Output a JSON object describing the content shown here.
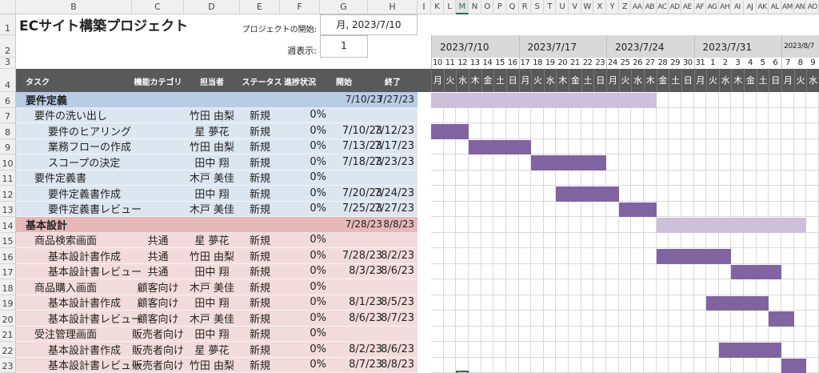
{
  "title": "ECサイト構築プロジェクト",
  "project_start_label": "プロジェクトの開始:",
  "project_start_value": "月, 2023/7/10",
  "week_display_label": "週表示:",
  "week_display_value": "1",
  "columns_left": [
    "B",
    "C",
    "D",
    "E",
    "F",
    "G",
    "H",
    "I"
  ],
  "columns_gantt": [
    "K",
    "L",
    "M",
    "N",
    "O",
    "P",
    "Q",
    "R",
    "S",
    "T",
    "U",
    "V",
    "W",
    "X",
    "Y",
    "Z",
    "AA",
    "AB",
    "AC",
    "AD",
    "AE",
    "AF",
    "AG",
    "AH",
    "AI",
    "AJ",
    "AK",
    "AL",
    "AM",
    "AN",
    "AO"
  ],
  "selected_column": "M",
  "headers": {
    "task": "タスク",
    "category": "機能カテゴリ",
    "owner": "担当者",
    "status": "ステータス",
    "progress": "進捗状況",
    "start": "開始",
    "end": "終了"
  },
  "weeks": [
    "2023/7/10",
    "2023/7/17",
    "2023/7/24",
    "2023/7/31",
    "2023/8/7"
  ],
  "day_numbers": [
    "10",
    "11",
    "12",
    "13",
    "14",
    "15",
    "16",
    "17",
    "18",
    "19",
    "20",
    "21",
    "22",
    "23",
    "24",
    "25",
    "26",
    "27",
    "28",
    "29",
    "30",
    "31",
    "1",
    "2",
    "3",
    "4",
    "5",
    "6",
    "7",
    "8",
    "9"
  ],
  "weekdays": [
    "月",
    "火",
    "水",
    "木",
    "金",
    "土",
    "日",
    "月",
    "火",
    "水",
    "木",
    "金",
    "土",
    "日",
    "月",
    "火",
    "水",
    "木",
    "金",
    "土",
    "日",
    "月",
    "火",
    "水",
    "木",
    "金",
    "土",
    "日",
    "月",
    "火",
    "水"
  ],
  "colors": {
    "header_dark": "#595959",
    "phase1": "#b8cce4",
    "phase1_light": "#dce6f1",
    "phase2": "#e6b8b7",
    "phase2_light": "#f2dcdb",
    "bar": "#8064a2",
    "bar_phase": "#ccc0da",
    "gantt_header": "#d9d9d9"
  },
  "rows": [
    {
      "num": "6",
      "level": 0,
      "phase": 1,
      "task": "要件定義",
      "category": "",
      "owner": "",
      "status": "",
      "progress": "",
      "start": "7/10/23",
      "end": "7/27/23"
    },
    {
      "num": "7",
      "level": 1,
      "phase": 1,
      "task": "要件の洗い出し",
      "category": "",
      "owner": "竹田 由梨",
      "status": "新規",
      "progress": "0%",
      "start": "",
      "end": ""
    },
    {
      "num": "8",
      "level": 2,
      "phase": 1,
      "task": "要件のヒアリング",
      "category": "",
      "owner": "星 夢花",
      "status": "新規",
      "progress": "0%",
      "start": "7/10/23",
      "end": "7/12/23"
    },
    {
      "num": "9",
      "level": 2,
      "phase": 1,
      "task": "業務フローの作成",
      "category": "",
      "owner": "竹田 由梨",
      "status": "新規",
      "progress": "0%",
      "start": "7/13/23",
      "end": "7/17/23"
    },
    {
      "num": "10",
      "level": 2,
      "phase": 1,
      "task": "スコープの決定",
      "category": "",
      "owner": "田中 翔",
      "status": "新規",
      "progress": "0%",
      "start": "7/18/23",
      "end": "7/23/23"
    },
    {
      "num": "11",
      "level": 1,
      "phase": 1,
      "task": "要件定義書",
      "category": "",
      "owner": "木戸 美佳",
      "status": "新規",
      "progress": "0%",
      "start": "",
      "end": ""
    },
    {
      "num": "12",
      "level": 2,
      "phase": 1,
      "task": "要件定義書作成",
      "category": "",
      "owner": "田中 翔",
      "status": "新規",
      "progress": "0%",
      "start": "7/20/23",
      "end": "7/24/23"
    },
    {
      "num": "13",
      "level": 2,
      "phase": 1,
      "task": "要件定義書レビュー",
      "category": "",
      "owner": "木戸 美佳",
      "status": "新規",
      "progress": "0%",
      "start": "7/25/23",
      "end": "7/27/23"
    },
    {
      "num": "14",
      "level": 0,
      "phase": 2,
      "task": "基本設計",
      "category": "",
      "owner": "",
      "status": "",
      "progress": "",
      "start": "7/28/23",
      "end": "8/8/23"
    },
    {
      "num": "15",
      "level": 1,
      "phase": 2,
      "task": "商品検索画面",
      "category": "共通",
      "owner": "星 夢花",
      "status": "新規",
      "progress": "0%",
      "start": "",
      "end": ""
    },
    {
      "num": "16",
      "level": 2,
      "phase": 2,
      "task": "基本設計書作成",
      "category": "共通",
      "owner": "竹田 由梨",
      "status": "新規",
      "progress": "0%",
      "start": "7/28/23",
      "end": "8/2/23"
    },
    {
      "num": "17",
      "level": 2,
      "phase": 2,
      "task": "基本設計書レビュー",
      "category": "共通",
      "owner": "田中 翔",
      "status": "新規",
      "progress": "0%",
      "start": "8/3/23",
      "end": "8/6/23"
    },
    {
      "num": "18",
      "level": 1,
      "phase": 2,
      "task": "商品購入画面",
      "category": "顧客向け",
      "owner": "木戸 美佳",
      "status": "新規",
      "progress": "0%",
      "start": "",
      "end": ""
    },
    {
      "num": "19",
      "level": 2,
      "phase": 2,
      "task": "基本設計書作成",
      "category": "顧客向け",
      "owner": "田中 翔",
      "status": "新規",
      "progress": "0%",
      "start": "8/1/23",
      "end": "8/5/23"
    },
    {
      "num": "20",
      "level": 2,
      "phase": 2,
      "task": "基本設計書レビュー",
      "category": "顧客向け",
      "owner": "木戸 美佳",
      "status": "新規",
      "progress": "0%",
      "start": "8/6/23",
      "end": "8/7/23"
    },
    {
      "num": "21",
      "level": 1,
      "phase": 2,
      "task": "受注管理画面",
      "category": "販売者向け",
      "owner": "田中 翔",
      "status": "新規",
      "progress": "0%",
      "start": "",
      "end": ""
    },
    {
      "num": "22",
      "level": 2,
      "phase": 2,
      "task": "基本設計書作成",
      "category": "販売者向け",
      "owner": "星 夢花",
      "status": "新規",
      "progress": "0%",
      "start": "8/2/23",
      "end": "8/6/23"
    },
    {
      "num": "23",
      "level": 2,
      "phase": 2,
      "task": "基本設計書レビュー",
      "category": "販売者向け",
      "owner": "竹田 由梨",
      "status": "新規",
      "progress": "0%",
      "start": "8/7/23",
      "end": "8/8/23"
    }
  ]
}
